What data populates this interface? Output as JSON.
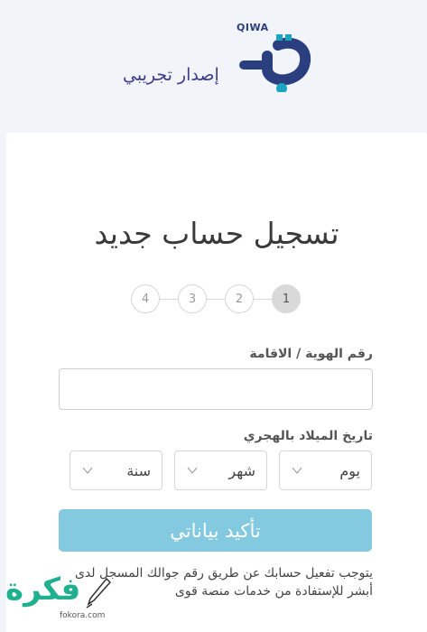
{
  "header": {
    "logo_brand": "QIWA",
    "logo_subtitle": "إصدار تجريبي"
  },
  "form": {
    "title": "تسجيل حساب جديد",
    "steps": [
      "1",
      "2",
      "3",
      "4"
    ],
    "active_step": 1,
    "id_label": "رقم الهوية / الاقامة",
    "id_value": "",
    "dob_label": "تاريخ الميلاد بالهجري",
    "day_label": "يوم",
    "month_label": "شهر",
    "year_label": "سنة",
    "submit_label": "تأكيد بياناتي",
    "note": "يتوجب تفعيل حسابك عن طريق رقم جوالك المسجل لدى أبشر للإستفادة من خدمات منصة قوى"
  },
  "watermark": {
    "text": "فكرة",
    "url": "fokora.com"
  },
  "colors": {
    "brand_blue": "#2b3f80",
    "brand_teal": "#1ba5c0",
    "button": "#83c9df",
    "page_bg": "#f1f4f8"
  }
}
